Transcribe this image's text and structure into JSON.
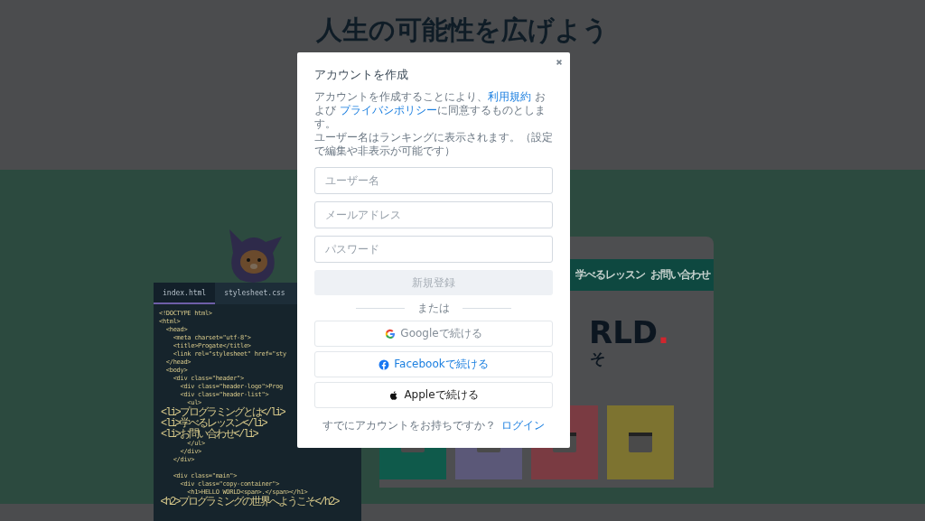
{
  "page": {
    "heading": "人生の可能性を広げよう",
    "editor": {
      "tabs": [
        {
          "label": "index.html",
          "selected": true
        },
        {
          "label": "stylesheet.css",
          "selected": false
        }
      ],
      "blocks": [
        [
          "<!DOCTYPE html>",
          "<html>",
          "  <head>",
          "    <meta charset=\"utf-8\">",
          "    <title>Progate</title>",
          "    <link rel=\"stylesheet\" href=\"sty",
          "  </head>",
          "  <body>",
          "    <div class=\"header\">",
          "      <div class=\"header-logo\">Prog",
          "      <div class=\"header-list\">",
          "        <ul>",
          "          <li>プログラミングとは</li>",
          "          <li>学べるレッスン</li>",
          "          <li>お問い合わせ</li>",
          "        </ul>",
          "      </div>",
          "    </div>"
        ],
        [
          "    <div class=\"main\">",
          "      <div class=\"copy-container\">",
          "        <h1>HELLO WORLD<span>.</span></h1>",
          "        <h2>プログラミングの世界へようこそ</h2>"
        ]
      ]
    },
    "preview": {
      "nav": [
        "学べるレッスン",
        "お問い合わせ"
      ],
      "hero_title": "RLD",
      "hero_accent": ".",
      "hero_sub": "そ",
      "tiles": [
        {
          "color": "#0f5a4b"
        },
        {
          "color": "#5b5878"
        },
        {
          "color": "#7a3b42"
        },
        {
          "color": "#7d7330"
        }
      ]
    }
  },
  "modal": {
    "title": "アカウントを作成",
    "notice": [
      {
        "kind": "text",
        "text": "アカウントを作成することにより、"
      },
      {
        "kind": "link",
        "text": "利用規約"
      },
      {
        "kind": "text",
        "text": " および "
      },
      {
        "kind": "link",
        "text": "プライバシポリシー"
      },
      {
        "kind": "text",
        "text": "に同意するものとします。"
      }
    ],
    "notice_2": "ユーザー名はランキングに表示されます。（設定で編集や非表示が可能です）",
    "fields": [
      {
        "placeholder": "ユーザー名"
      },
      {
        "placeholder": "メールアドレス"
      },
      {
        "placeholder": "パスワード"
      }
    ],
    "submit": {
      "label": "新規登録",
      "disabled": true
    },
    "divider": "または",
    "social": [
      {
        "kind": "google",
        "label": "Googleで続ける"
      },
      {
        "kind": "facebook",
        "label": "Facebookで続ける"
      },
      {
        "kind": "apple",
        "label": "Appleで続ける"
      }
    ],
    "footer": "すでにアカウントをお持ちですか？",
    "login": "ログイン"
  }
}
